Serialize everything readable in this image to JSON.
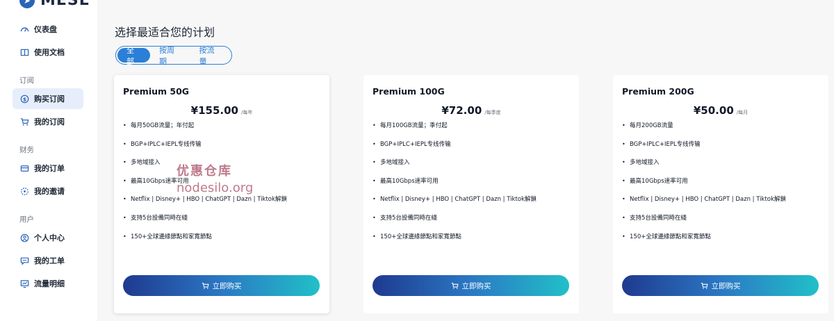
{
  "app": {
    "logo_text": "MESL"
  },
  "sidebar": {
    "items": [
      {
        "label": "仪表盘",
        "icon": "dashboard-icon"
      },
      {
        "label": "使用文档",
        "icon": "book-icon"
      },
      {
        "label": "购买订阅",
        "icon": "dollar-icon",
        "active": true
      },
      {
        "label": "我的订阅",
        "icon": "cart-icon"
      },
      {
        "label": "我的订单",
        "icon": "card-icon"
      },
      {
        "label": "我的邀请",
        "icon": "invite-icon"
      },
      {
        "label": "个人中心",
        "icon": "user-icon"
      },
      {
        "label": "我的工单",
        "icon": "ticket-icon"
      },
      {
        "label": "流量明细",
        "icon": "chart-icon"
      }
    ],
    "groups": [
      "订阅",
      "财务",
      "用户"
    ]
  },
  "main": {
    "title": "选择最适合您的计划",
    "tabs": [
      {
        "label": "全部",
        "active": true
      },
      {
        "label": "按周期"
      },
      {
        "label": "按流量"
      }
    ]
  },
  "plans": [
    {
      "name": "Premium 50G",
      "price": "¥155.00",
      "period": "/每年",
      "features": [
        "每月50GB流量；年付起",
        "BGP+IPLC+IEPL专线传输",
        "多地域接入",
        "最高10Gbps速率可用",
        "Netflix | Disney+ | HBO | ChatGPT | Dazn | Tiktok解鎖",
        "支持5台設備同時在綫",
        "150+全球邊緣節點和家寬節點"
      ],
      "button": "立即购买"
    },
    {
      "name": "Premium 100G",
      "price": "¥72.00",
      "period": "/每季度",
      "features": [
        "每月100GB流量；季付起",
        "BGP+IPLC+IEPL专线传输",
        "多地域接入",
        "最高10Gbps速率可用",
        "Netflix | Disney+ | HBO | ChatGPT | Dazn | Tiktok解鎖",
        "支持5台設備同時在綫",
        "150+全球邊緣節點和家寬節點"
      ],
      "button": "立即购买"
    },
    {
      "name": "Premium 200G",
      "price": "¥50.00",
      "period": "/每月",
      "features": [
        "每月200GB流量",
        "BGP+IPLC+IEPL专线传输",
        "多地域接入",
        "最高10Gbps速率可用",
        "Netflix | Disney+ | HBO | ChatGPT | Dazn | Tiktok解鎖",
        "支持5台設備同時在綫",
        "150+全球邊緣節點和家寬節點"
      ],
      "button": "立即购买"
    }
  ],
  "watermark": {
    "line1": "优惠仓库",
    "line2": "nodesilo.org"
  },
  "colors": {
    "accent": "#2b7fd6",
    "active_bg": "#e6eefb",
    "button_start": "#1f3a8f",
    "button_end": "#21c0c8"
  }
}
